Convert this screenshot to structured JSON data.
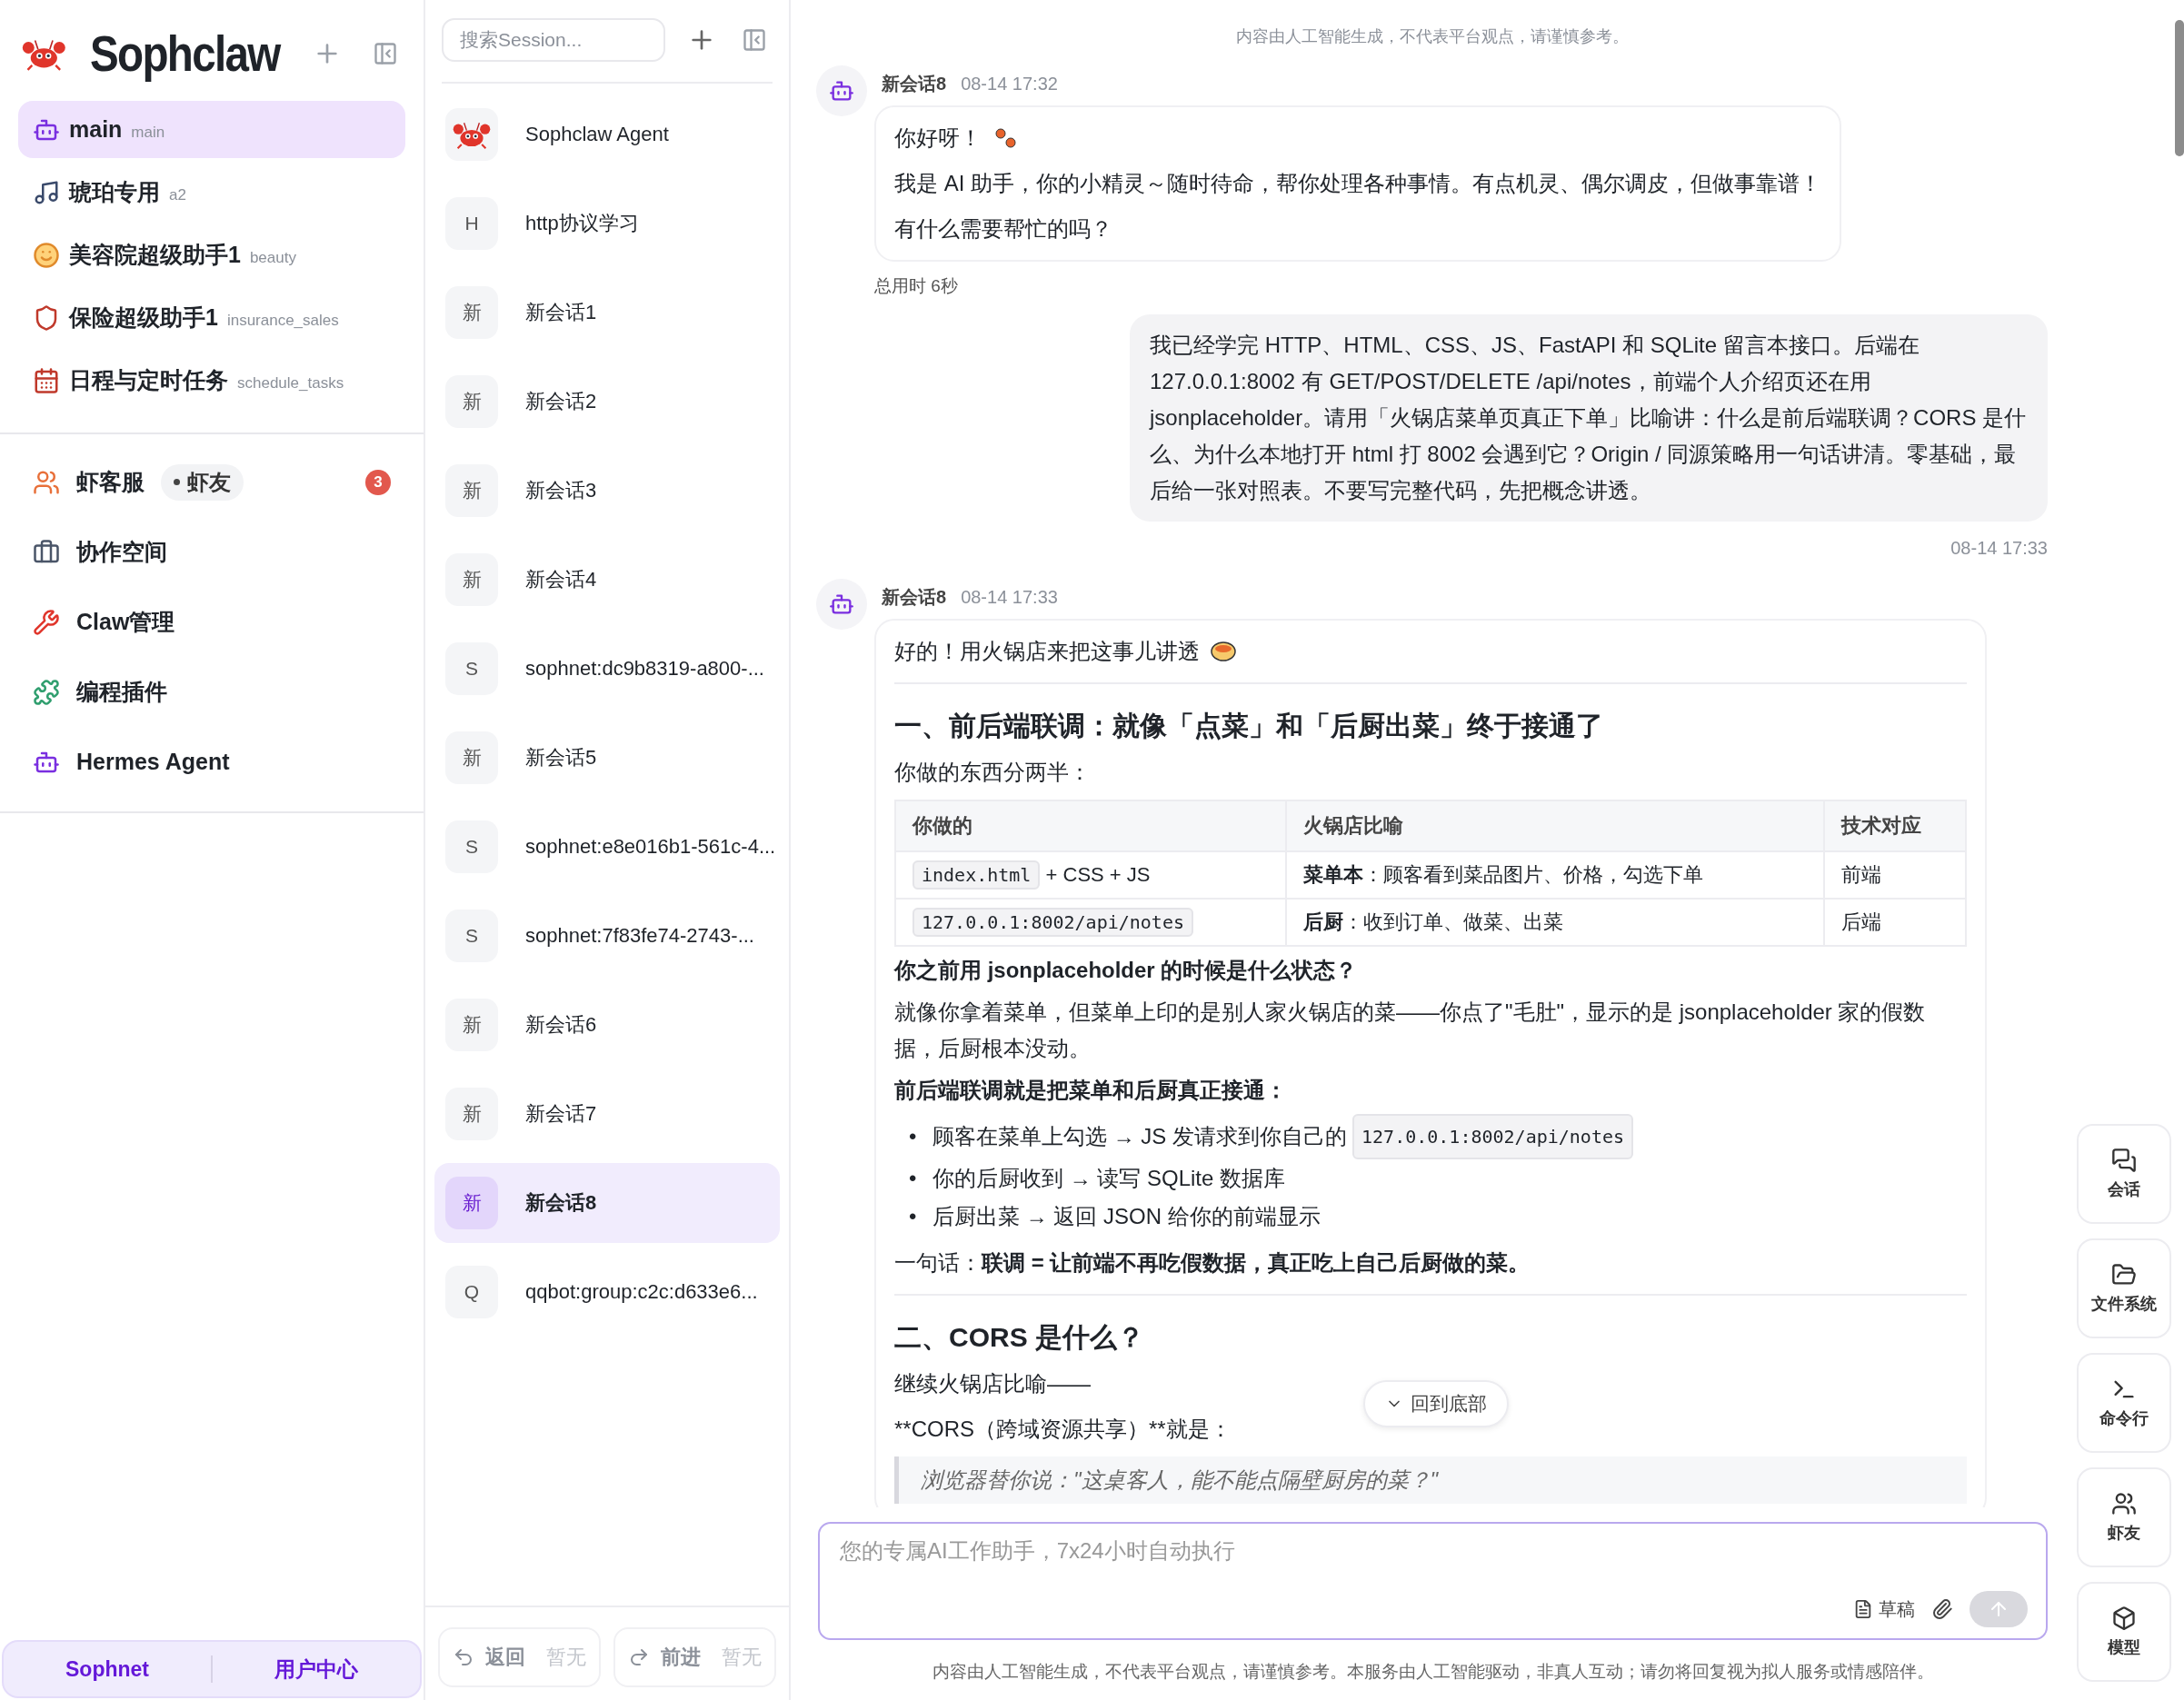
{
  "brand": {
    "title": "Sophclaw"
  },
  "agents": [
    {
      "kind": "bot",
      "name": "main",
      "sub": "main",
      "selected": true
    },
    {
      "kind": "music",
      "name": "琥珀专用",
      "sub": "a2",
      "selected": false
    },
    {
      "kind": "smile",
      "name": "美容院超级助手1",
      "sub": "beauty",
      "selected": false
    },
    {
      "kind": "shield",
      "name": "保险超级助手1",
      "sub": "insurance_sales",
      "selected": false
    },
    {
      "kind": "calendar",
      "name": "日程与定时任务",
      "sub": "schedule_tasks",
      "selected": false
    }
  ],
  "nav": [
    {
      "kind": "users",
      "label": "虾客服",
      "tag": "虾友",
      "badge": "3"
    },
    {
      "kind": "briefcase",
      "label": "协作空间"
    },
    {
      "kind": "wrench",
      "label": "Claw管理"
    },
    {
      "kind": "puzzle",
      "label": "编程插件"
    },
    {
      "kind": "bot",
      "label": "Hermes Agent"
    }
  ],
  "sidebar_footer": [
    "Sophnet",
    "用户中心"
  ],
  "session_search": {
    "placeholder": "搜索Session..."
  },
  "sessions": [
    {
      "kind": "crab",
      "title": "Sophclaw Agent",
      "selected": false
    },
    {
      "kind": "letter",
      "avatar": "H",
      "title": "http协议学习",
      "selected": false
    },
    {
      "kind": "letter",
      "avatar": "新",
      "title": "新会话1",
      "selected": false
    },
    {
      "kind": "letter",
      "avatar": "新",
      "title": "新会话2",
      "selected": false
    },
    {
      "kind": "letter",
      "avatar": "新",
      "title": "新会话3",
      "selected": false
    },
    {
      "kind": "letter",
      "avatar": "新",
      "title": "新会话4",
      "selected": false
    },
    {
      "kind": "letter",
      "avatar": "S",
      "title": "sophnet:dc9b8319-a800-...",
      "selected": false
    },
    {
      "kind": "letter",
      "avatar": "新",
      "title": "新会话5",
      "selected": false
    },
    {
      "kind": "letter",
      "avatar": "S",
      "title": "sophnet:e8e016b1-561c-4...",
      "selected": false
    },
    {
      "kind": "letter",
      "avatar": "S",
      "title": "sophnet:7f83fe74-2743-...",
      "selected": false
    },
    {
      "kind": "letter",
      "avatar": "新",
      "title": "新会话6",
      "selected": false
    },
    {
      "kind": "letter",
      "avatar": "新",
      "title": "新会话7",
      "selected": false
    },
    {
      "kind": "letter",
      "avatar": "新",
      "title": "新会话8",
      "selected": true
    },
    {
      "kind": "letter",
      "avatar": "Q",
      "title": "qqbot:group:c2c:d633e6...",
      "selected": false
    }
  ],
  "session_footer": [
    {
      "kind": "back",
      "label": "返回",
      "hint": "暂无",
      "disabled": true
    },
    {
      "kind": "forward",
      "label": "前进",
      "hint": "暂无",
      "disabled": true
    }
  ],
  "chat": {
    "notice": "内容由人工智能生成，不代表平台观点，请谨慎参考。",
    "messages": [
      {
        "kind": "bot",
        "name": "新会话8",
        "time": "08-14 17:32",
        "footnote": "总用时 6秒",
        "blocks": [
          {
            "kind": "greeting",
            "text": "你好呀！"
          },
          {
            "kind": "p",
            "text": "我是 AI 助手，你的小精灵～随时待命，帮你处理各种事情。有点机灵、偶尔调皮，但做事靠谱！"
          },
          {
            "kind": "p",
            "text": "有什么需要帮忙的吗？"
          }
        ]
      },
      {
        "kind": "user",
        "time": "08-14 17:33",
        "text": "我已经学完 HTTP、HTML、CSS、JS、FastAPI 和 SQLite 留言本接口。后端在 127.0.0.1:8002 有 GET/POST/DELETE /api/notes，前端个人介绍页还在用 jsonplaceholder。请用「火锅店菜单页真正下单」比喻讲：什么是前后端联调？CORS 是什么、为什么本地打开 html 打 8002 会遇到它？Origin / 同源策略用一句话讲清。零基础，最后给一张对照表。不要写完整代码，先把概念讲透。"
      },
      {
        "kind": "bot",
        "name": "新会话8",
        "time": "08-14 17:33",
        "blocks": [
          {
            "kind": "bowl",
            "text": "好的！用火锅店来把这事儿讲透"
          },
          {
            "kind": "hr"
          },
          {
            "kind": "h2",
            "text": "一、前后端联调：就像「点菜」和「后厨出菜」终于接通了"
          },
          {
            "kind": "p",
            "text": "你做的东西分两半："
          },
          {
            "kind": "table",
            "columns": [
              "你做的",
              "火锅店比喻",
              "技术对应"
            ],
            "rows": [
              [
                {
                  "code": "index.html",
                  "text": " + CSS + JS"
                },
                {
                  "text": "**菜单本**：顾客看到菜品图片、价格，勾选下单"
                },
                {
                  "text": "前端"
                }
              ],
              [
                {
                  "code": "127.0.0.1:8002/api/notes"
                },
                {
                  "text": "**后厨**：收到订单、做菜、出菜"
                },
                {
                  "text": "后端"
                }
              ]
            ]
          },
          {
            "kind": "h4",
            "text": "你之前用 jsonplaceholder 的时候是什么状态？"
          },
          {
            "kind": "p",
            "text": "就像你拿着菜单，但菜单上印的是别人家火锅店的菜——你点了\"毛肚\"，显示的是 jsonplaceholder 家的假数据，后厨根本没动。"
          },
          {
            "kind": "h4",
            "text": "前后端联调就是把菜单和后厨真正接通："
          },
          {
            "kind": "list",
            "items": [
              {
                "marker": "•",
                "text": "顾客在菜单上勾选 → JS 发请求到你自己的 ",
                "code": "127.0.0.1:8002/api/notes"
              },
              {
                "marker": "•",
                "text": "你的后厨收到 → 读写 SQLite 数据库"
              },
              {
                "marker": "•",
                "text": "后厨出菜 → 返回 JSON 给你的前端显示"
              }
            ]
          },
          {
            "kind": "rich",
            "text": "一句话：**联调 = 让前端不再吃假数据，真正吃上自己后厨做的菜。**"
          },
          {
            "kind": "hr"
          },
          {
            "kind": "h2",
            "text": "二、CORS 是什么？"
          },
          {
            "kind": "p",
            "text": "继续火锅店比喻——"
          },
          {
            "kind": "p",
            "text": "**CORS（跨域资源共享）**就是："
          },
          {
            "kind": "quote",
            "text": "浏览器替你说：\"这桌客人，能不能点隔壁厨房的菜？\""
          }
        ]
      }
    ],
    "scroll_button": "回到底部",
    "input": {
      "placeholder": "您的专属AI工作助手，7x24小时自动执行",
      "draft": "草稿"
    },
    "disclaimer": "内容由人工智能生成，不代表平台观点，请谨慎参考。本服务由人工智能驱动，非真人互动；请勿将回复视为拟人服务或情感陪伴。"
  },
  "rail": [
    {
      "kind": "chat",
      "label": "会话"
    },
    {
      "kind": "folder",
      "label": "文件系统"
    },
    {
      "kind": "terminal",
      "label": "命令行"
    },
    {
      "kind": "users",
      "label": "虾友"
    },
    {
      "kind": "model",
      "label": "模型"
    }
  ]
}
